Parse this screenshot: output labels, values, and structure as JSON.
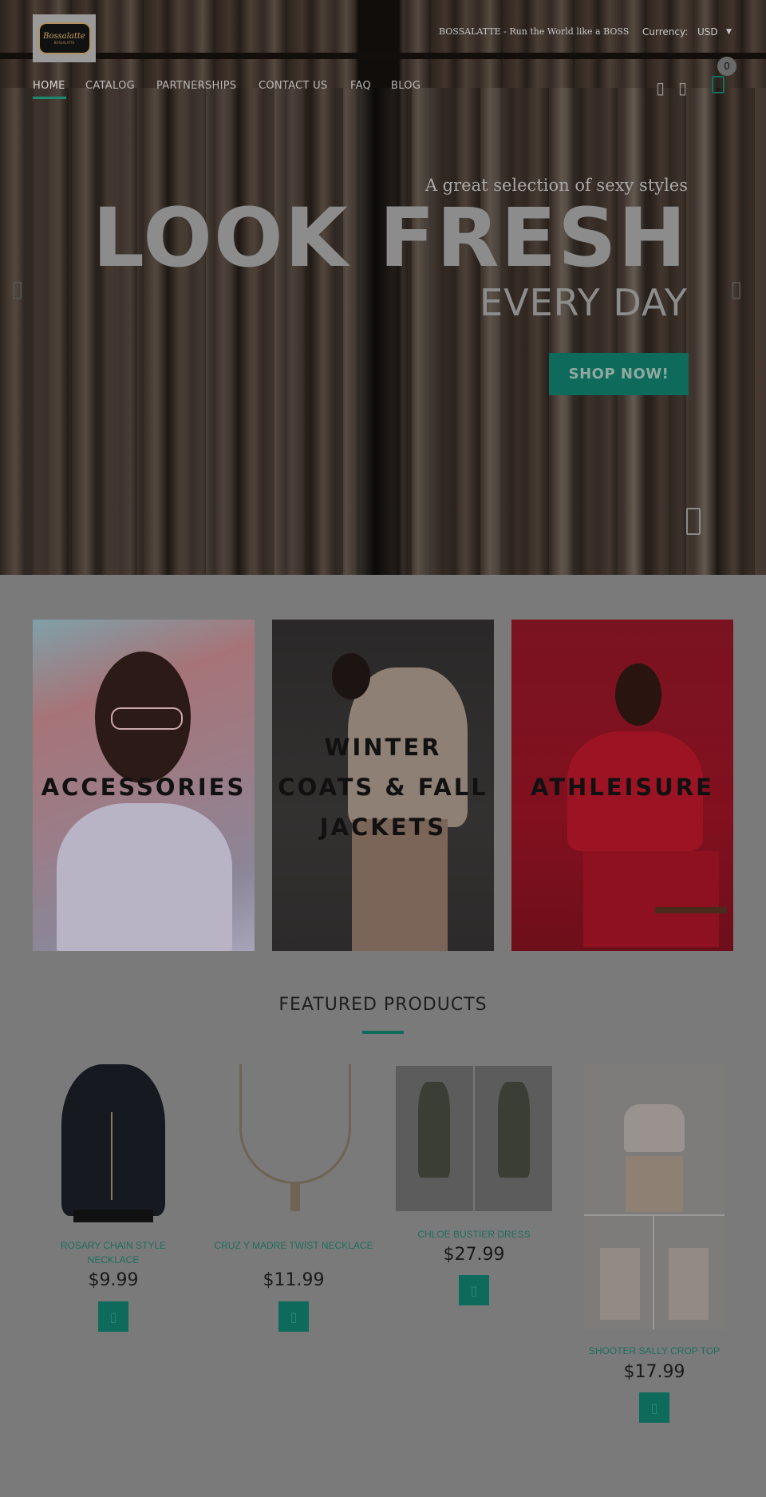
{
  "header": {
    "logo_text": "Bossalatte",
    "logo_sub": "BOSSALATTE",
    "tagline": "BOSSALATTE - Run the World like a BOSS",
    "currency_label": "Currency:",
    "currency_value": "USD",
    "cart_count": "0",
    "nav": [
      "HOME",
      "CATALOG",
      "PARTNERSHIPS",
      "CONTACT US",
      "FAQ",
      "BLOG"
    ],
    "icons": [
      "user-icon",
      "search-icon",
      "cart-icon"
    ]
  },
  "hero": {
    "tagline": "A great selection of sexy styles",
    "headline": "LOOK FRESH",
    "subline": "EVERY DAY",
    "button": "SHOP NOW!",
    "prev_icon": "chevron-left-icon",
    "next_icon": "chevron-right-icon"
  },
  "collections": [
    {
      "label": "ACCESSORIES"
    },
    {
      "label": "WINTER COATS & FALL JACKETS"
    },
    {
      "label": "ATHLEISURE"
    }
  ],
  "featured": {
    "title": "FEATURED PRODUCTS",
    "products": [
      {
        "name": "ROSARY CHAIN STYLE NECKLACE",
        "price": "$9.99"
      },
      {
        "name": "CRUZ Y MADRE TWIST NECKLACE",
        "price": "$11.99"
      },
      {
        "name": "CHLOE BUSTIER DRESS",
        "price": "$27.99"
      },
      {
        "name": "SHOOTER SALLY CROP TOP",
        "price": "$17.99"
      }
    ],
    "add_icon": "cart-add-icon"
  },
  "colors": {
    "accent": "#0e6b5b",
    "overlay": "#7a7a7a"
  }
}
